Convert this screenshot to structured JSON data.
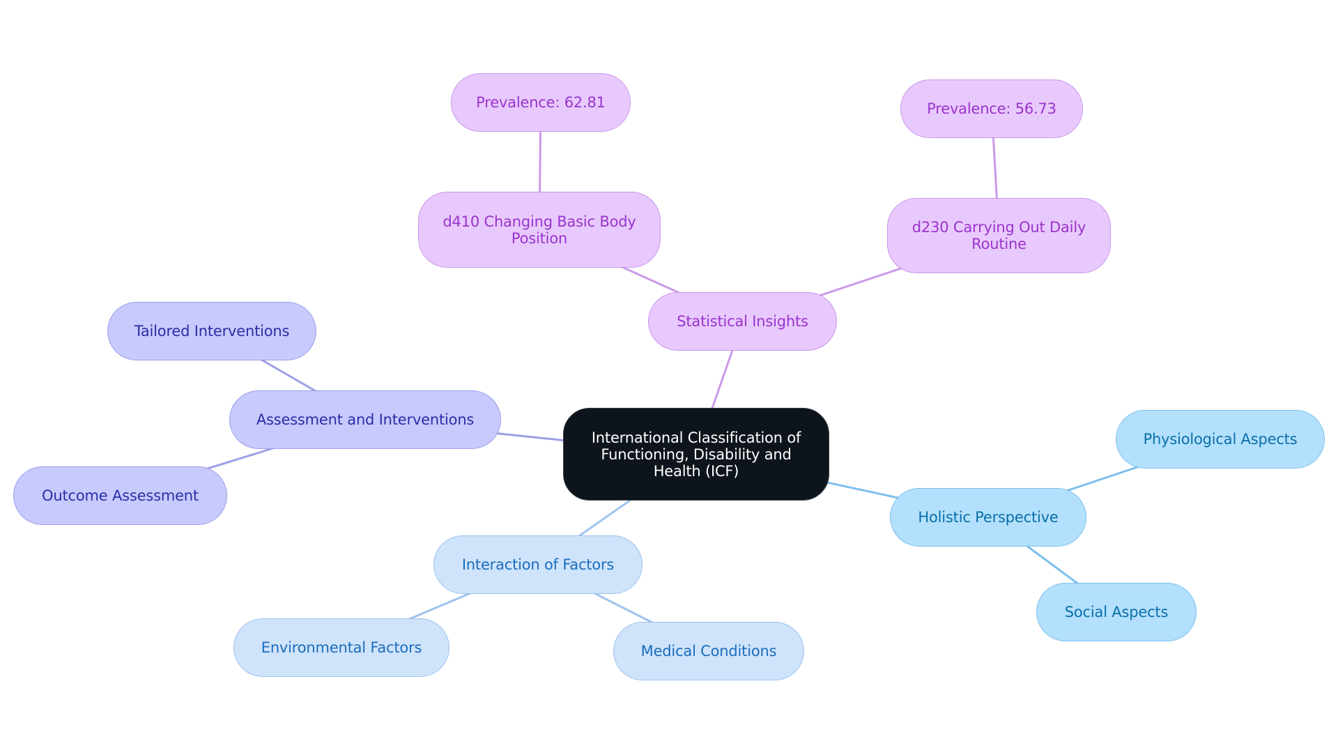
{
  "diagram": {
    "type": "mindmap",
    "root": {
      "id": "icf",
      "label": "International Classification of Functioning, Disability and Health (ICF)"
    },
    "nodes": [
      {
        "id": "stat",
        "label": "Statistical Insights",
        "parent": "icf",
        "theme": "purple"
      },
      {
        "id": "d410",
        "label": "d410 Changing Basic Body Position",
        "parent": "stat",
        "theme": "purple"
      },
      {
        "id": "prev1",
        "label": "Prevalence: 62.81",
        "parent": "d410",
        "theme": "purple"
      },
      {
        "id": "d230",
        "label": "d230 Carrying Out Daily Routine",
        "parent": "stat",
        "theme": "purple"
      },
      {
        "id": "prev2",
        "label": "Prevalence: 56.73",
        "parent": "d230",
        "theme": "purple"
      },
      {
        "id": "assess",
        "label": "Assessment and Interventions",
        "parent": "icf",
        "theme": "lavender"
      },
      {
        "id": "tailored",
        "label": "Tailored Interventions",
        "parent": "assess",
        "theme": "lavender"
      },
      {
        "id": "outcome",
        "label": "Outcome Assessment",
        "parent": "assess",
        "theme": "lavender"
      },
      {
        "id": "holistic",
        "label": "Holistic Perspective",
        "parent": "icf",
        "theme": "sky"
      },
      {
        "id": "physio",
        "label": "Physiological Aspects",
        "parent": "holistic",
        "theme": "sky"
      },
      {
        "id": "social",
        "label": "Social Aspects",
        "parent": "holistic",
        "theme": "sky"
      },
      {
        "id": "interaction",
        "label": "Interaction of Factors",
        "parent": "icf",
        "theme": "pale"
      },
      {
        "id": "env",
        "label": "Environmental Factors",
        "parent": "interaction",
        "theme": "pale"
      },
      {
        "id": "medical",
        "label": "Medical Conditions",
        "parent": "interaction",
        "theme": "pale"
      }
    ],
    "edge_colors": {
      "purple": "#c99ae8",
      "lavender": "#9b9fe6",
      "sky": "#7cc0ec",
      "pale": "#9dc3ee"
    }
  }
}
